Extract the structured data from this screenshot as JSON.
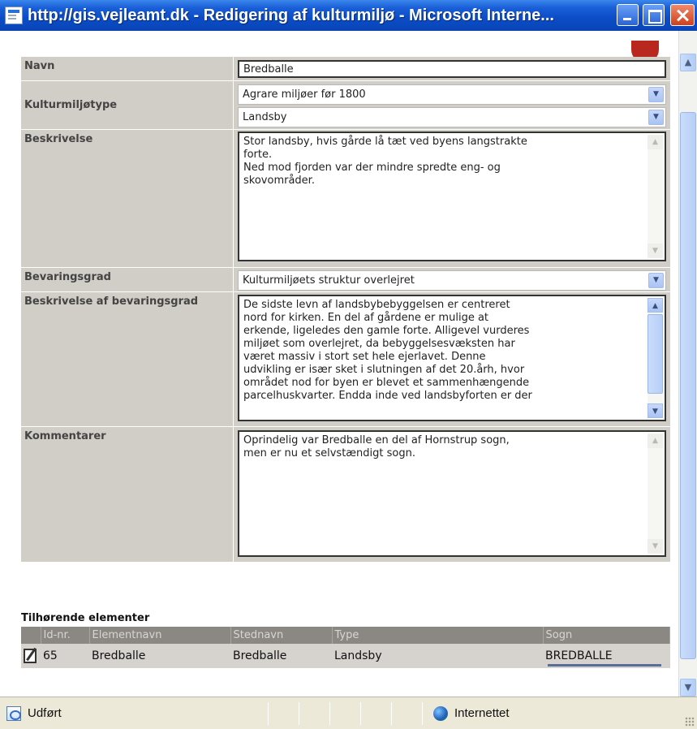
{
  "window": {
    "title": "http://gis.vejleamt.dk - Redigering af kulturmiljø - Microsoft Interne..."
  },
  "form": {
    "navn": {
      "label": "Navn",
      "value": "Bredballe"
    },
    "kulturmiljotype": {
      "label": "Kulturmiljøtype",
      "select1": "Agrare miljøer før 1800",
      "select2": "Landsby"
    },
    "beskrivelse": {
      "label": "Beskrivelse",
      "lines": [
        "Stor landsby, hvis gårde lå tæt ved byens langstrakte",
        "forte.",
        "Ned mod fjorden var der mindre spredte eng- og",
        "skovområder."
      ]
    },
    "bevaringsgrad": {
      "label": "Bevaringsgrad",
      "value": "Kulturmiljøets struktur overlejret"
    },
    "beskrivelse_bevaringsgrad": {
      "label": "Beskrivelse af bevaringsgrad",
      "lines": [
        "De sidste levn af landsbybebyggelsen er centreret",
        "nord for kirken. En del af gårdene er mulige at",
        "erkende, ligeledes den gamle forte. Alligevel vurderes",
        "miljøet som overlejret, da bebyggelsesvæksten har",
        "været massiv i stort set hele ejerlavet. Denne",
        "udvikling er især sket i slutningen af det 20.årh, hvor",
        "området nod for byen er blevet et sammenhængende",
        "parcelhuskvarter. Endda inde ved landsbyforten er der"
      ]
    },
    "kommentarer": {
      "label": "Kommentarer",
      "lines": [
        "Oprindelig var Bredballe en del af Hornstrup sogn,",
        "men er nu et selvstændigt sogn."
      ]
    }
  },
  "related": {
    "title": "Tilhørende elementer",
    "columns": [
      "Id-nr.",
      "Elementnavn",
      "Stednavn",
      "Type",
      "Sogn"
    ],
    "rows": [
      {
        "id": "65",
        "elementnavn": "Bredballe",
        "stednavn": "Bredballe",
        "type": "Landsby",
        "sogn": "BREDBALLE"
      }
    ]
  },
  "statusbar": {
    "status": "Udført",
    "zone": "Internettet"
  },
  "icons": {
    "window": "ie-page-icon",
    "edit": "edit-pencil-icon",
    "zone": "internet-globe-icon"
  }
}
